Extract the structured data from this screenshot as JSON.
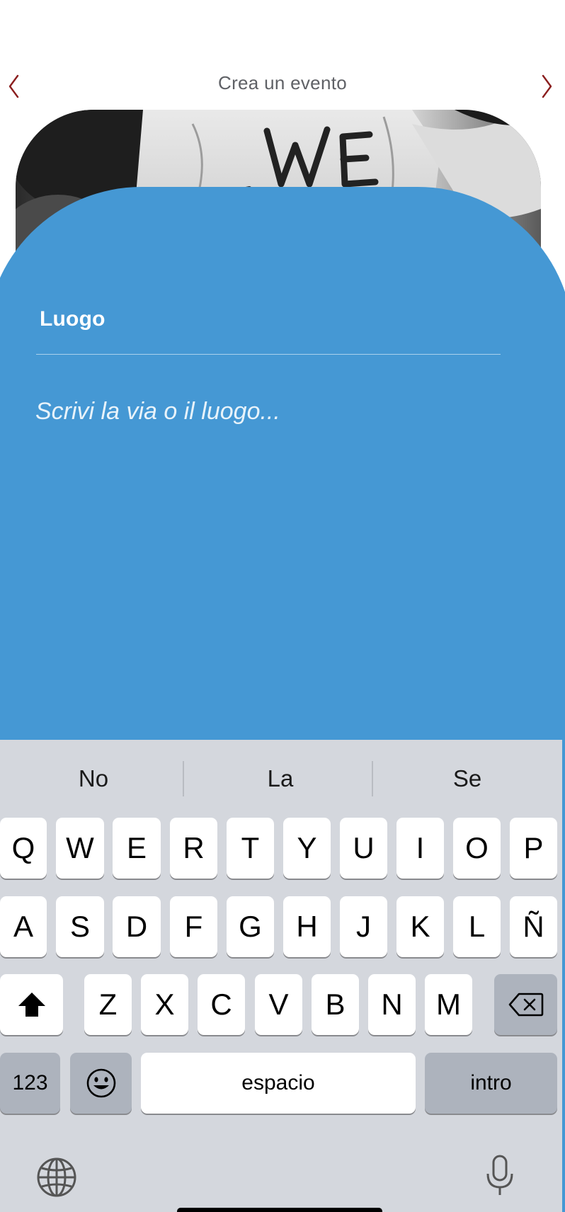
{
  "header": {
    "title": "Crea un evento"
  },
  "colors": {
    "panel_blue": "#4598d4",
    "nav_arrow": "#8b1e1e",
    "keyboard_bg": "#d4d7dd"
  },
  "hero": {
    "icon": "photo-hands-we"
  },
  "form": {
    "label": "Luogo",
    "placeholder": "Scrivi la via o il luogo..."
  },
  "keyboard": {
    "suggestions": [
      "No",
      "La",
      "Se"
    ],
    "row1": [
      "Q",
      "W",
      "E",
      "R",
      "T",
      "Y",
      "U",
      "I",
      "O",
      "P"
    ],
    "row2": [
      "A",
      "S",
      "D",
      "F",
      "G",
      "H",
      "J",
      "K",
      "L",
      "Ñ"
    ],
    "row3": [
      "Z",
      "X",
      "C",
      "V",
      "B",
      "N",
      "M"
    ],
    "numbers_label": "123",
    "space_label": "espacio",
    "return_label": "intro",
    "shift_icon": "shift-icon",
    "delete_icon": "delete-icon",
    "emoji_icon": "emoji-icon",
    "globe_icon": "globe-icon",
    "mic_icon": "microphone-icon"
  }
}
